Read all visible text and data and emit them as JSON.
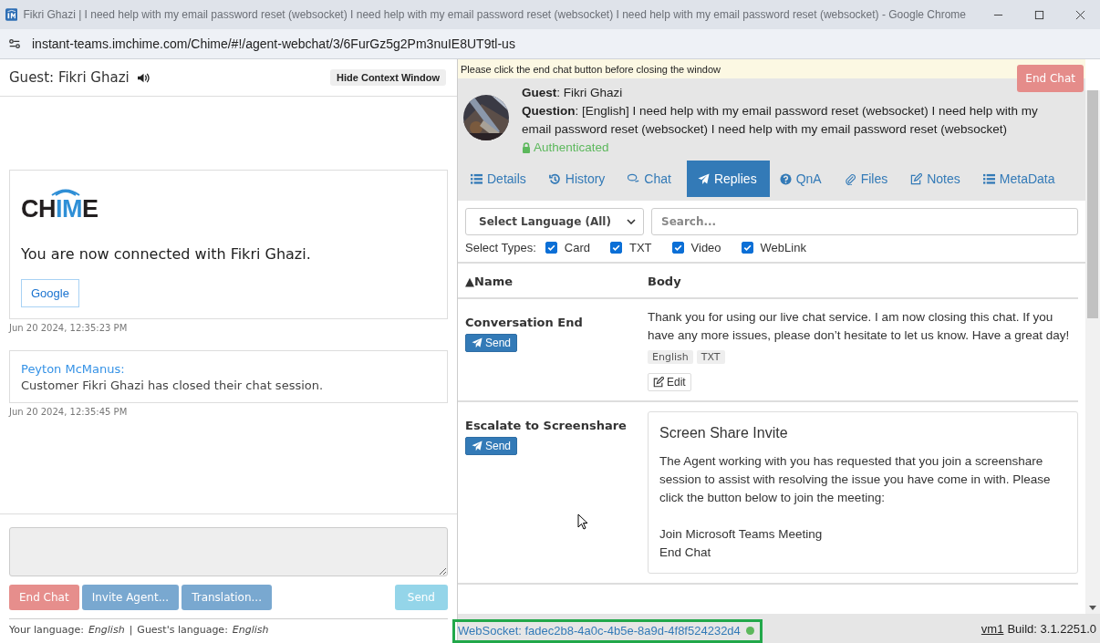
{
  "window": {
    "title": "Fikri Ghazi | I need help with my email password reset (websocket) I need help with my email password reset (websocket) I need help with my email password reset (websocket) - Google Chrome"
  },
  "address_bar": {
    "url": "instant-teams.imchime.com/Chime/#!/agent-webchat/3/6FurGz5g2Pm3nuIE8UT9tl-us"
  },
  "chat_panel": {
    "guest_title": "Guest: Fikri Ghazi",
    "hide_button": "Hide Context Window",
    "messages": [
      {
        "kind": "card",
        "logo_left": "CH",
        "logo_mid": "IM",
        "logo_right": "E",
        "text": "You are now connected with Fikri Ghazi.",
        "button": "Google",
        "time": "Jun 20 2024, 12:35:23 PM"
      },
      {
        "kind": "message",
        "sender": "Peyton McManus:",
        "text": "Customer Fikri Ghazi has closed their chat session.",
        "time": "Jun 20 2024, 12:35:45 PM"
      }
    ],
    "buttons": [
      {
        "label": "End Chat",
        "kind": "danger",
        "disabled": true
      },
      {
        "label": "Invite Agent...",
        "kind": "primary",
        "disabled": true
      },
      {
        "label": "Translation...",
        "kind": "primary",
        "disabled": true
      }
    ],
    "send_button": {
      "label": "Send",
      "disabled": true
    },
    "your_language_label": "Your language:",
    "your_language": "English",
    "separator": "|",
    "guest_language_label": "Guest's language:",
    "guest_language": "English"
  },
  "context_panel": {
    "notice": "Please click the end chat button before closing the window",
    "end_chat_button": "End Chat",
    "guest": "**Guest**: Fikri Ghazi",
    "question": "**Question**: [English] I need help with my email password reset (websocket) I need help with my email password reset (websocket) I need help with my email password reset (websocket)",
    "authenticated": "Authenticated",
    "tabs": [
      {
        "label": "Details",
        "selected": false
      },
      {
        "label": "History",
        "selected": false
      },
      {
        "label": "Chat",
        "selected": false
      },
      {
        "label": "Replies",
        "selected": true
      },
      {
        "label": "QnA",
        "selected": false
      },
      {
        "label": "Files",
        "selected": false
      },
      {
        "label": "Notes",
        "selected": false
      },
      {
        "label": "MetaData",
        "selected": false
      }
    ],
    "language_select": "Select Language (All)",
    "search": {
      "placeholder": "Search..."
    },
    "types_label": "Select Types:",
    "types": [
      {
        "label": "Card",
        "checked": true
      },
      {
        "label": "TXT",
        "checked": true
      },
      {
        "label": "Video",
        "checked": true
      },
      {
        "label": "WebLink",
        "checked": true
      }
    ],
    "columns": [
      "▲Name",
      "Body"
    ],
    "replies": [
      {
        "kind": "text",
        "name": "Conversation End",
        "send": "Send",
        "body": "Thank you for using our live chat service. I am now closing this chat. If you have any more issues, please don’t hesitate to let us know. Have a great day!",
        "tags": [
          "English",
          "TXT"
        ],
        "edit": "Edit"
      },
      {
        "kind": "card",
        "name": "Escalate to Screenshare",
        "send": "Send",
        "card_title": "Screen Share Invite",
        "body": "The Agent working with you has requested that you join a screenshare session to assist with resolving the issue you have come in with. Please click the button below to join the meeting:",
        "lines": [
          "Join Microsoft Teams Meeting",
          "End Chat"
        ]
      }
    ]
  },
  "status_bar": {
    "websocket": "WebSocket: fadec2b8-4a0c-4b5e-8a9d-4f8f524232d4",
    "connected": true,
    "server": "vm1",
    "build": "Build: 3.1.2251.0"
  }
}
